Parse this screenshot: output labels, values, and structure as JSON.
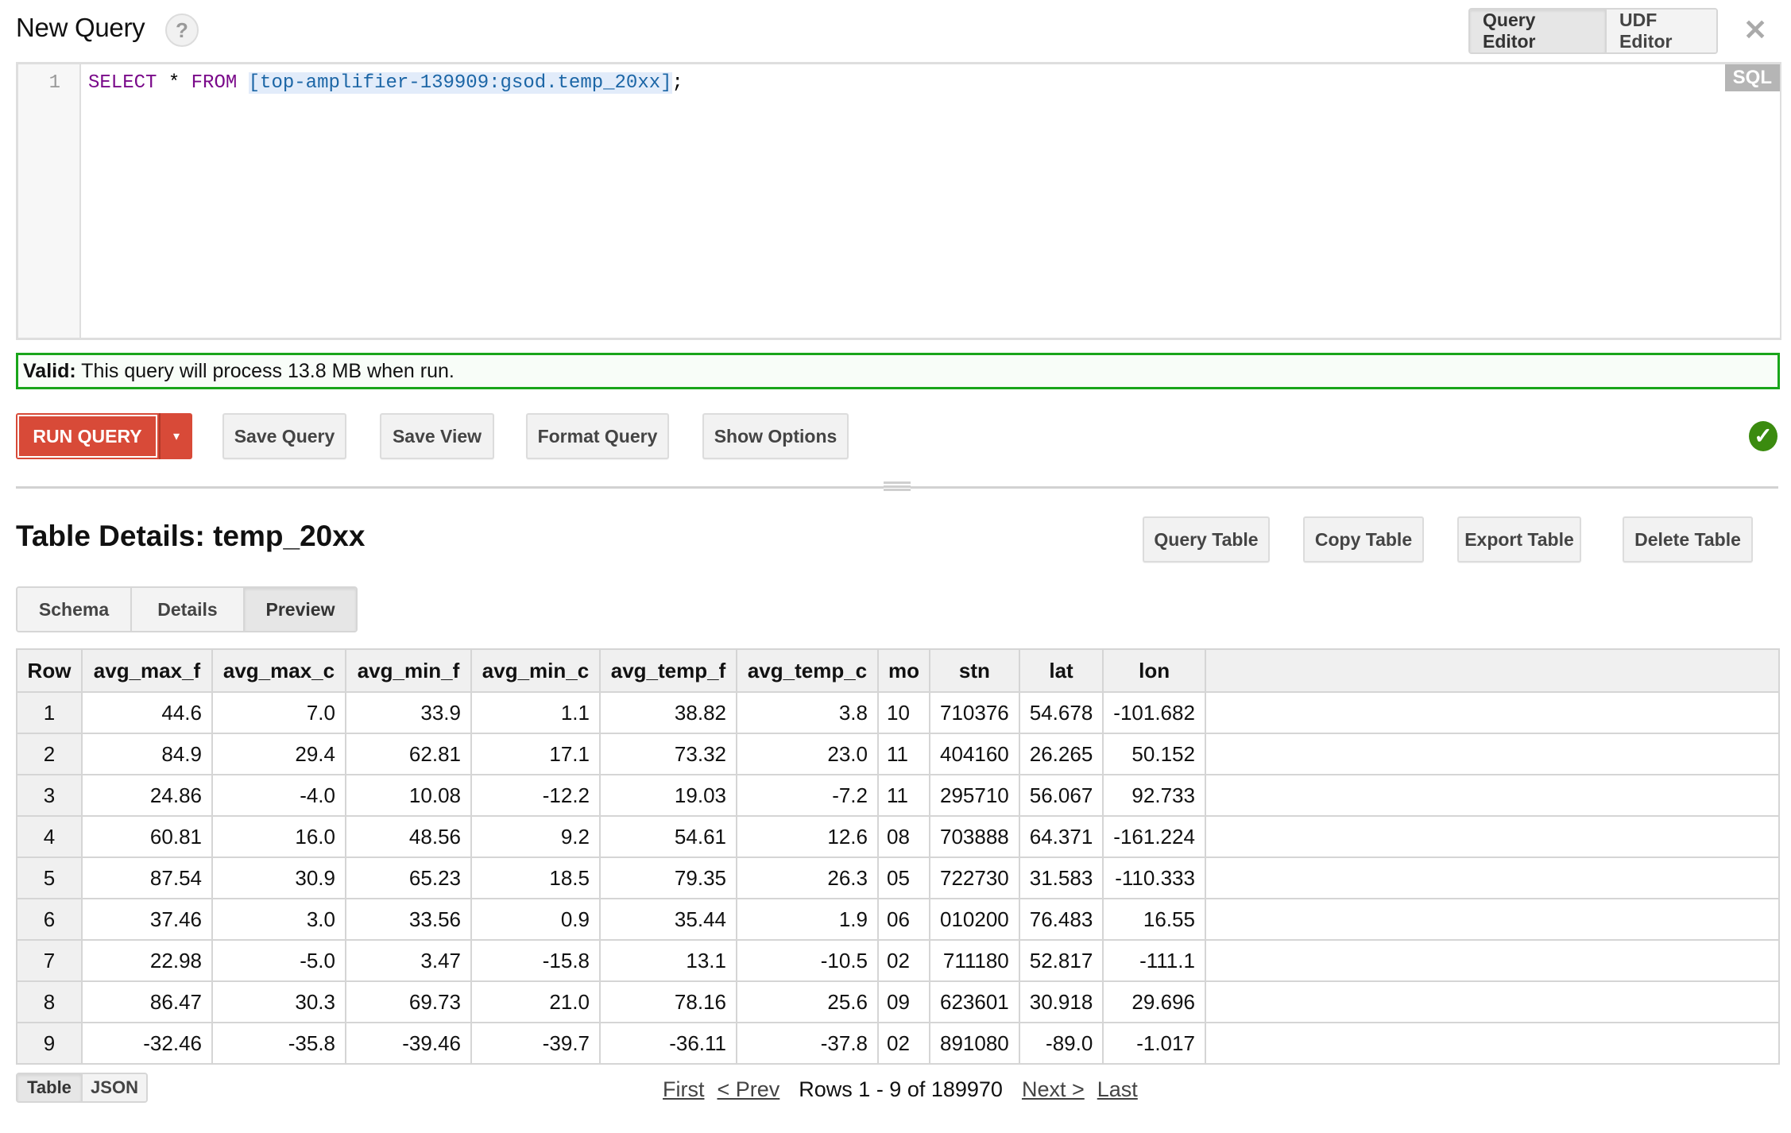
{
  "header": {
    "title": "New Query",
    "help_label": "?",
    "editor_tabs": [
      {
        "label": "Query Editor",
        "active": true
      },
      {
        "label": "UDF Editor",
        "active": false
      }
    ],
    "close_icon": "close-icon"
  },
  "editor": {
    "line_number": "1",
    "code": {
      "kw_select": "SELECT",
      "star": " * ",
      "kw_from": "FROM",
      "space": " ",
      "table_ref": "[top-amplifier-139909:gsod.temp_20xx]",
      "terminator": ";"
    },
    "language_badge": "SQL"
  },
  "validation": {
    "label": "Valid:",
    "message": " This query will process 13.8 MB when run.",
    "status_color": "#19a51a"
  },
  "actions": {
    "run_query": "RUN QUERY",
    "run_dropdown_icon": "▾",
    "save_query": "Save Query",
    "save_view": "Save View",
    "format_query": "Format Query",
    "show_options": "Show Options",
    "status_icon": "✓",
    "run_color": "#d84a38"
  },
  "table_details": {
    "title": "Table Details: temp_20xx",
    "buttons": {
      "query_table": "Query Table",
      "copy_table": "Copy Table",
      "export_table": "Export Table",
      "delete_table": "Delete Table"
    },
    "tabs": [
      {
        "label": "Schema",
        "active": false
      },
      {
        "label": "Details",
        "active": false
      },
      {
        "label": "Preview",
        "active": true
      }
    ]
  },
  "preview": {
    "columns": [
      "Row",
      "avg_max_f",
      "avg_max_c",
      "avg_min_f",
      "avg_min_c",
      "avg_temp_f",
      "avg_temp_c",
      "mo",
      "stn",
      "lat",
      "lon"
    ],
    "rows": [
      [
        "1",
        "44.6",
        "7.0",
        "33.9",
        "1.1",
        "38.82",
        "3.8",
        "10",
        "710376",
        "54.678",
        "-101.682"
      ],
      [
        "2",
        "84.9",
        "29.4",
        "62.81",
        "17.1",
        "73.32",
        "23.0",
        "11",
        "404160",
        "26.265",
        "50.152"
      ],
      [
        "3",
        "24.86",
        "-4.0",
        "10.08",
        "-12.2",
        "19.03",
        "-7.2",
        "11",
        "295710",
        "56.067",
        "92.733"
      ],
      [
        "4",
        "60.81",
        "16.0",
        "48.56",
        "9.2",
        "54.61",
        "12.6",
        "08",
        "703888",
        "64.371",
        "-161.224"
      ],
      [
        "5",
        "87.54",
        "30.9",
        "65.23",
        "18.5",
        "79.35",
        "26.3",
        "05",
        "722730",
        "31.583",
        "-110.333"
      ],
      [
        "6",
        "37.46",
        "3.0",
        "33.56",
        "0.9",
        "35.44",
        "1.9",
        "06",
        "010200",
        "76.483",
        "16.55"
      ],
      [
        "7",
        "22.98",
        "-5.0",
        "3.47",
        "-15.8",
        "13.1",
        "-10.5",
        "02",
        "711180",
        "52.817",
        "-111.1"
      ],
      [
        "8",
        "86.47",
        "30.3",
        "69.73",
        "21.0",
        "78.16",
        "25.6",
        "09",
        "623601",
        "30.918",
        "29.696"
      ],
      [
        "9",
        "-32.46",
        "-35.8",
        "-39.46",
        "-39.7",
        "-36.11",
        "-37.8",
        "02",
        "891080",
        "-89.0",
        "-1.017"
      ]
    ]
  },
  "results_view": {
    "tabs": [
      {
        "label": "Table",
        "active": true
      },
      {
        "label": "JSON",
        "active": false
      }
    ]
  },
  "pagination": {
    "first": "First",
    "prev": "< Prev",
    "rows_info": "Rows 1 - 9 of 189970",
    "next": "Next >",
    "last": "Last"
  }
}
